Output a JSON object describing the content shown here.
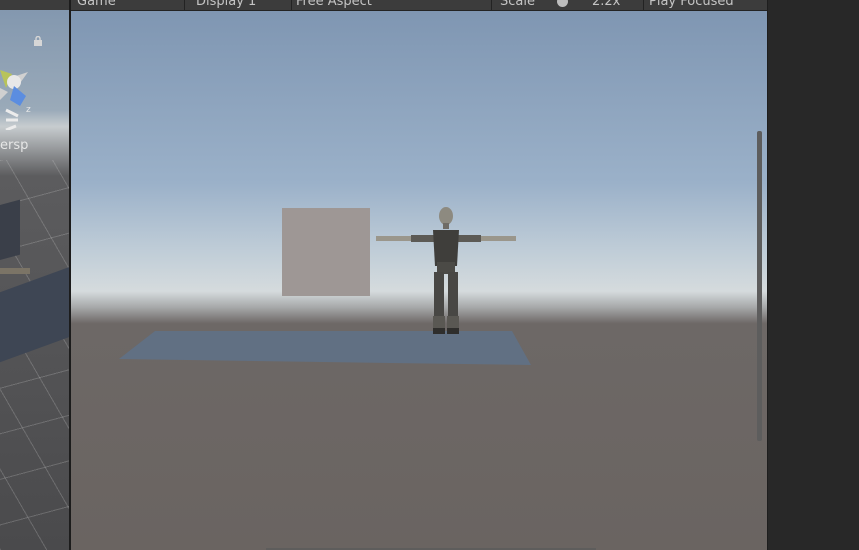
{
  "scene_view": {
    "camera_label": "ersp",
    "gizmo_axis_label": "z"
  },
  "game_view": {
    "tab_label": "Game",
    "display_select": "Display 1",
    "aspect_select": "Free Aspect",
    "scale_label": "Scale",
    "scale_value": "2.2x",
    "play_mode": "Play Focused"
  },
  "icons": {
    "lock": "lock-icon",
    "gizmo": "scene-gizmo-icon"
  },
  "colors": {
    "editor_bg": "#282828",
    "toolbar_bg": "#3c3c3c",
    "plane": "#617083",
    "box": "#9e9795"
  }
}
